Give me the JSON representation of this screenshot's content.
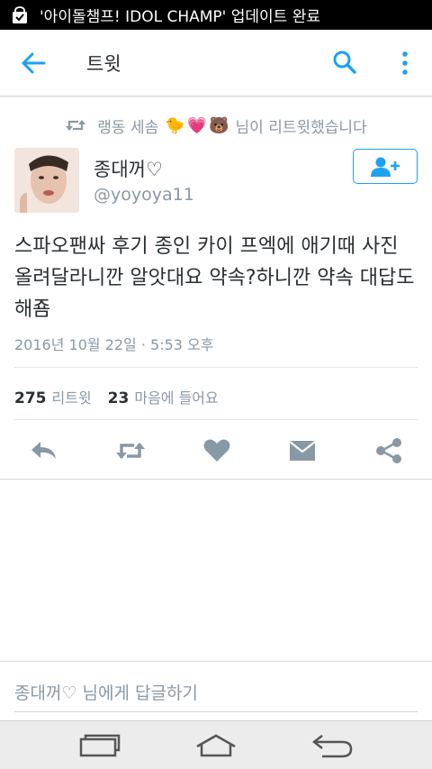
{
  "status_bar": {
    "notification": "'아이돌챔프! IDOL CHAMP' 업데이트 완료",
    "icon": "shopping-bag-icon"
  },
  "app_bar": {
    "title": "트윗",
    "back_icon": "back-arrow-icon",
    "search_icon": "search-icon",
    "more_icon": "more-vert-icon"
  },
  "retweet_context": {
    "name": "랭동 세솜",
    "emojis": [
      "🐤",
      "💗",
      "🐻"
    ],
    "suffix": "님이 리트윗했습니다",
    "icon": "retweet-icon"
  },
  "tweet": {
    "display_name": "종대꺼♡",
    "handle": "@yoyoya11",
    "text": "스파오팬싸 후기 종인 카이  프엑에 애기때 사진 올려달라니깐 알앗대요 약속?하니깐 약속 대답도해죰",
    "timestamp": "2016년 10월 22일 · 5:53 오후",
    "retweets": "275",
    "retweets_label": "리트윗",
    "likes": "23",
    "likes_label": "마음에 들어요"
  },
  "follow_button": {
    "icon": "add-user-icon"
  },
  "actions": [
    "reply-icon",
    "retweet-icon",
    "heart-icon",
    "message-icon",
    "share-icon"
  ],
  "reply_box": {
    "placeholder": "종대꺼♡ 님에게 답글하기"
  },
  "colors": {
    "accent": "#1da1f2",
    "muted": "#8899a6",
    "text": "#292f33"
  }
}
